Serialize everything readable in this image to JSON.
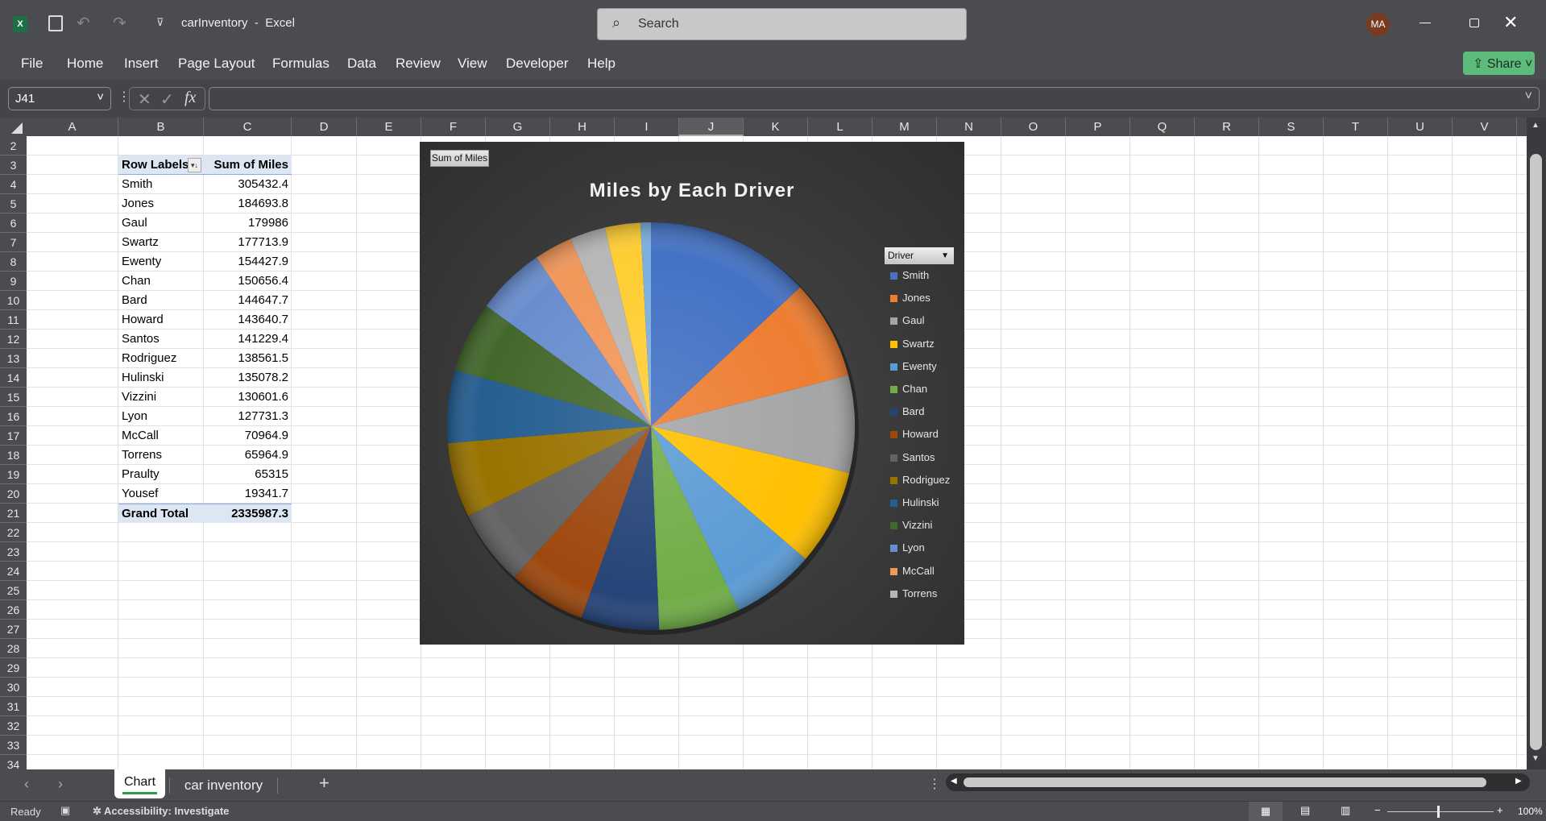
{
  "app": {
    "title": "carInventory",
    "app_name": "Excel",
    "separator": "-",
    "search_placeholder": "Search",
    "user_initials": "MA",
    "share_label": "Share"
  },
  "menu": [
    "File",
    "Home",
    "Insert",
    "Page Layout",
    "Formulas",
    "Data",
    "Review",
    "View",
    "Developer",
    "Help"
  ],
  "formula": {
    "name_box": "J41",
    "fx": "fx",
    "cancel": "✕",
    "enter": "✓",
    "value": ""
  },
  "columns": [
    "A",
    "B",
    "C",
    "D",
    "E",
    "F",
    "G",
    "H",
    "I",
    "J",
    "K",
    "L",
    "M",
    "N",
    "O",
    "P",
    "Q",
    "R",
    "S",
    "T",
    "U",
    "V"
  ],
  "selected_column": "J",
  "rows": [
    2,
    3,
    4,
    5,
    6,
    7,
    8,
    9,
    10,
    11,
    12,
    13,
    14,
    15,
    16,
    17,
    18,
    19,
    20,
    21,
    22,
    23,
    24,
    25,
    26,
    27,
    28,
    29,
    30,
    31,
    32,
    33,
    34
  ],
  "pivot": {
    "header_label": "Row Labels",
    "header_value": "Sum of Miles",
    "filter_icon": "▾↓",
    "rows": [
      [
        "Smith",
        "305432.4"
      ],
      [
        "Jones",
        "184693.8"
      ],
      [
        "Gaul",
        "179986"
      ],
      [
        "Swartz",
        "177713.9"
      ],
      [
        "Ewenty",
        "154427.9"
      ],
      [
        "Chan",
        "150656.4"
      ],
      [
        "Bard",
        "144647.7"
      ],
      [
        "Howard",
        "143640.7"
      ],
      [
        "Santos",
        "141229.4"
      ],
      [
        "Rodriguez",
        "138561.5"
      ],
      [
        "Hulinski",
        "135078.2"
      ],
      [
        "Vizzini",
        "130601.6"
      ],
      [
        "Lyon",
        "127731.3"
      ],
      [
        "McCall",
        "70964.9"
      ],
      [
        "Torrens",
        "65964.9"
      ],
      [
        "Praulty",
        "65315"
      ],
      [
        "Yousef",
        "19341.7"
      ]
    ],
    "total_label": "Grand Total",
    "total_value": "2335987.3"
  },
  "chart": {
    "field_button": "Sum of Miles",
    "title": "Miles by Each Driver",
    "legend_field": "Driver",
    "legend": [
      "Smith",
      "Jones",
      "Gaul",
      "Swartz",
      "Ewenty",
      "Chan",
      "Bard",
      "Howard",
      "Santos",
      "Rodriguez",
      "Hulinski",
      "Vizzini",
      "Lyon",
      "McCall",
      "Torrens"
    ]
  },
  "chart_data": {
    "type": "pie",
    "title": "Miles by Each Driver",
    "legend_placement": "right",
    "categories": [
      "Smith",
      "Jones",
      "Gaul",
      "Swartz",
      "Ewenty",
      "Chan",
      "Bard",
      "Howard",
      "Santos",
      "Rodriguez",
      "Hulinski",
      "Vizzini",
      "Lyon",
      "McCall",
      "Torrens",
      "Praulty",
      "Yousef"
    ],
    "values": [
      305432.4,
      184693.8,
      179986,
      177713.9,
      154427.9,
      150656.4,
      144647.7,
      143640.7,
      141229.4,
      138561.5,
      135078.2,
      130601.6,
      127731.3,
      70964.9,
      65964.9,
      65315,
      19341.7
    ],
    "colors": [
      "#4472C4",
      "#ED7D31",
      "#A5A5A5",
      "#FFC000",
      "#5B9BD5",
      "#70AD47",
      "#264478",
      "#9E480E",
      "#636363",
      "#997300",
      "#255E91",
      "#43682B",
      "#698ED0",
      "#F1975A",
      "#B7B7B7",
      "#FFCD33",
      "#7CAFDD"
    ]
  },
  "sheets": {
    "tabs": [
      "Chart",
      "car inventory"
    ],
    "active": "Chart",
    "add": "+"
  },
  "status": {
    "ready": "Ready",
    "accessibility": "Accessibility: Investigate",
    "zoom": "100%",
    "zoom_minus": "−",
    "zoom_plus": "+"
  },
  "colors": {
    "share": "#5dbb7c",
    "avatar": "#7a3a22",
    "active_tab_underline": "#2e9a4e"
  }
}
